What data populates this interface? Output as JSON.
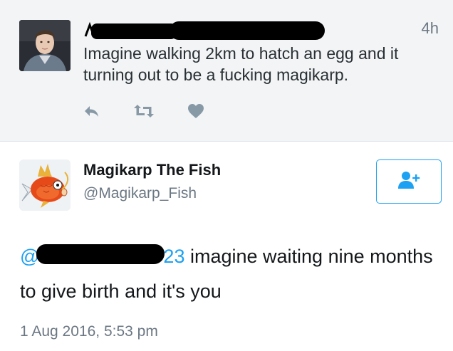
{
  "parent_tweet": {
    "time": "4h",
    "text": "Imagine walking 2km to hatch an egg and it turning out to be a fucking magikarp.",
    "actions": [
      {
        "icon": "reply-icon"
      },
      {
        "icon": "retweet-icon"
      },
      {
        "icon": "like-icon"
      }
    ]
  },
  "reply_tweet": {
    "name": "Magikarp The Fish",
    "handle": "@Magikarp_Fish",
    "mention_prefix": "@",
    "mention_suffix": "23",
    "text": " imagine waiting nine months to give birth and it's you",
    "date": "1 Aug 2016, 5:53 pm",
    "follow_icon": "follow-user-icon"
  },
  "colors": {
    "accent": "#1da1f2",
    "muted_text": "#6b7783",
    "action_icon": "#8899a6",
    "parent_background": "#f2f4f6"
  }
}
